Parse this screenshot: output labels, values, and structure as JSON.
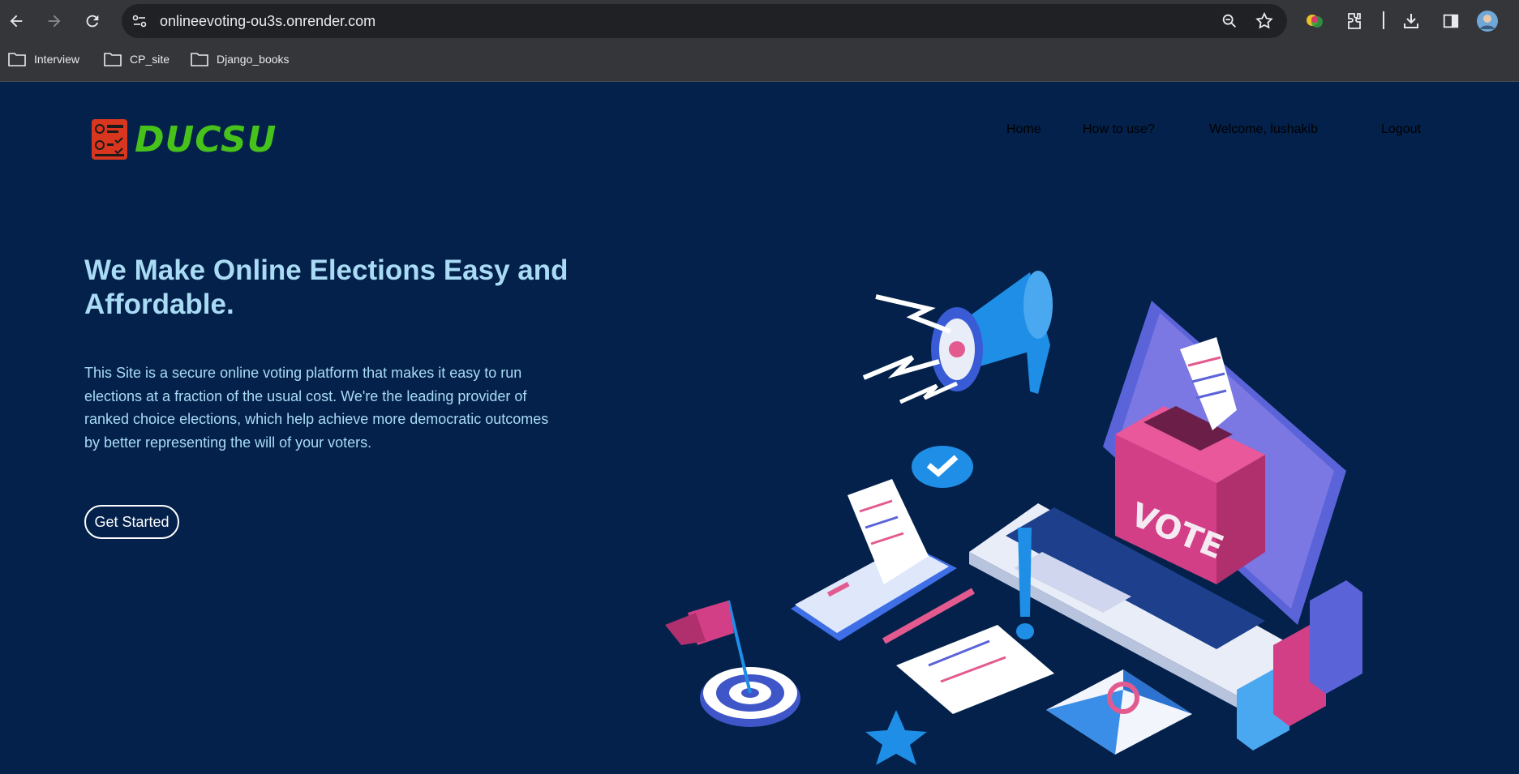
{
  "browser": {
    "url": "onlineevoting-ou3s.onrender.com",
    "bookmarks": [
      {
        "label": "Interview"
      },
      {
        "label": "CP_site"
      },
      {
        "label": "Django_books"
      }
    ]
  },
  "site": {
    "logo_text": "DUCSU",
    "nav": [
      {
        "label": "Home"
      },
      {
        "label": "How to use?"
      },
      {
        "label": "Welcome, lushakib"
      },
      {
        "label": "Logout"
      }
    ],
    "hero": {
      "title": "We Make Online Elections Easy and Affordable.",
      "description": "This Site is a secure online voting platform that makes it easy to run elections at a fraction of the usual cost. We're the leading provider of ranked choice elections, which help achieve more democratic outcomes by better representing the will of your voters.",
      "cta_label": "Get Started"
    },
    "illustration": {
      "ballot_box_label": "VOTE"
    }
  },
  "colors": {
    "page_bg": "#03214a",
    "hero_text": "#a9dbf5",
    "logo_green": "#46c21b",
    "accent_pink": "#c73a78",
    "accent_blue": "#1f8ee6"
  }
}
